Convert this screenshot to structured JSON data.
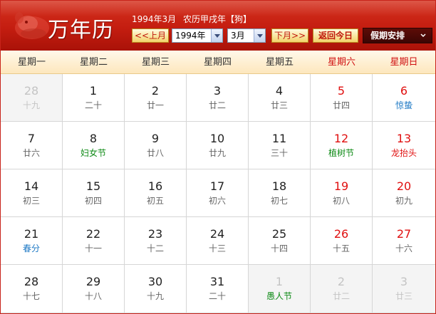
{
  "header": {
    "title": "万年历",
    "info": {
      "date": "1994年3月",
      "lunar": "农历甲戌年【狗】"
    },
    "prev_label": "<<上月",
    "next_label": "下月>>",
    "today_label": "返回今日",
    "year_select": "1994年",
    "month_select": "3月",
    "holiday_label": "假期安排",
    "colors": {
      "header_red": "#c41d10",
      "weekend_red": "#e01010",
      "festival_green": "#0e8a16",
      "solar_term_blue": "#1c78c4"
    }
  },
  "weekdays": [
    "星期一",
    "星期二",
    "星期三",
    "星期四",
    "星期五",
    "星期六",
    "星期日"
  ],
  "days": [
    {
      "day": "28",
      "lunar": "十九",
      "other": true
    },
    {
      "day": "1",
      "lunar": "二十"
    },
    {
      "day": "2",
      "lunar": "廿一"
    },
    {
      "day": "3",
      "lunar": "廿二"
    },
    {
      "day": "4",
      "lunar": "廿三"
    },
    {
      "day": "5",
      "lunar": "廿四"
    },
    {
      "day": "6",
      "lunar": "惊蛰",
      "kind": "term"
    },
    {
      "day": "7",
      "lunar": "廿六"
    },
    {
      "day": "8",
      "lunar": "妇女节",
      "kind": "fest-green"
    },
    {
      "day": "9",
      "lunar": "廿八"
    },
    {
      "day": "10",
      "lunar": "廿九"
    },
    {
      "day": "11",
      "lunar": "三十"
    },
    {
      "day": "12",
      "lunar": "植树节",
      "kind": "fest-green"
    },
    {
      "day": "13",
      "lunar": "龙抬头",
      "kind": "fest-red"
    },
    {
      "day": "14",
      "lunar": "初三"
    },
    {
      "day": "15",
      "lunar": "初四"
    },
    {
      "day": "16",
      "lunar": "初五"
    },
    {
      "day": "17",
      "lunar": "初六"
    },
    {
      "day": "18",
      "lunar": "初七"
    },
    {
      "day": "19",
      "lunar": "初八"
    },
    {
      "day": "20",
      "lunar": "初九"
    },
    {
      "day": "21",
      "lunar": "春分",
      "kind": "term"
    },
    {
      "day": "22",
      "lunar": "十一"
    },
    {
      "day": "23",
      "lunar": "十二"
    },
    {
      "day": "24",
      "lunar": "十三"
    },
    {
      "day": "25",
      "lunar": "十四"
    },
    {
      "day": "26",
      "lunar": "十五"
    },
    {
      "day": "27",
      "lunar": "十六"
    },
    {
      "day": "28",
      "lunar": "十七"
    },
    {
      "day": "29",
      "lunar": "十八"
    },
    {
      "day": "30",
      "lunar": "十九"
    },
    {
      "day": "31",
      "lunar": "二十"
    },
    {
      "day": "1",
      "lunar": "愚人节",
      "other": true,
      "kind": "fest-green"
    },
    {
      "day": "2",
      "lunar": "廿二",
      "other": true
    },
    {
      "day": "3",
      "lunar": "廿三",
      "other": true
    }
  ]
}
